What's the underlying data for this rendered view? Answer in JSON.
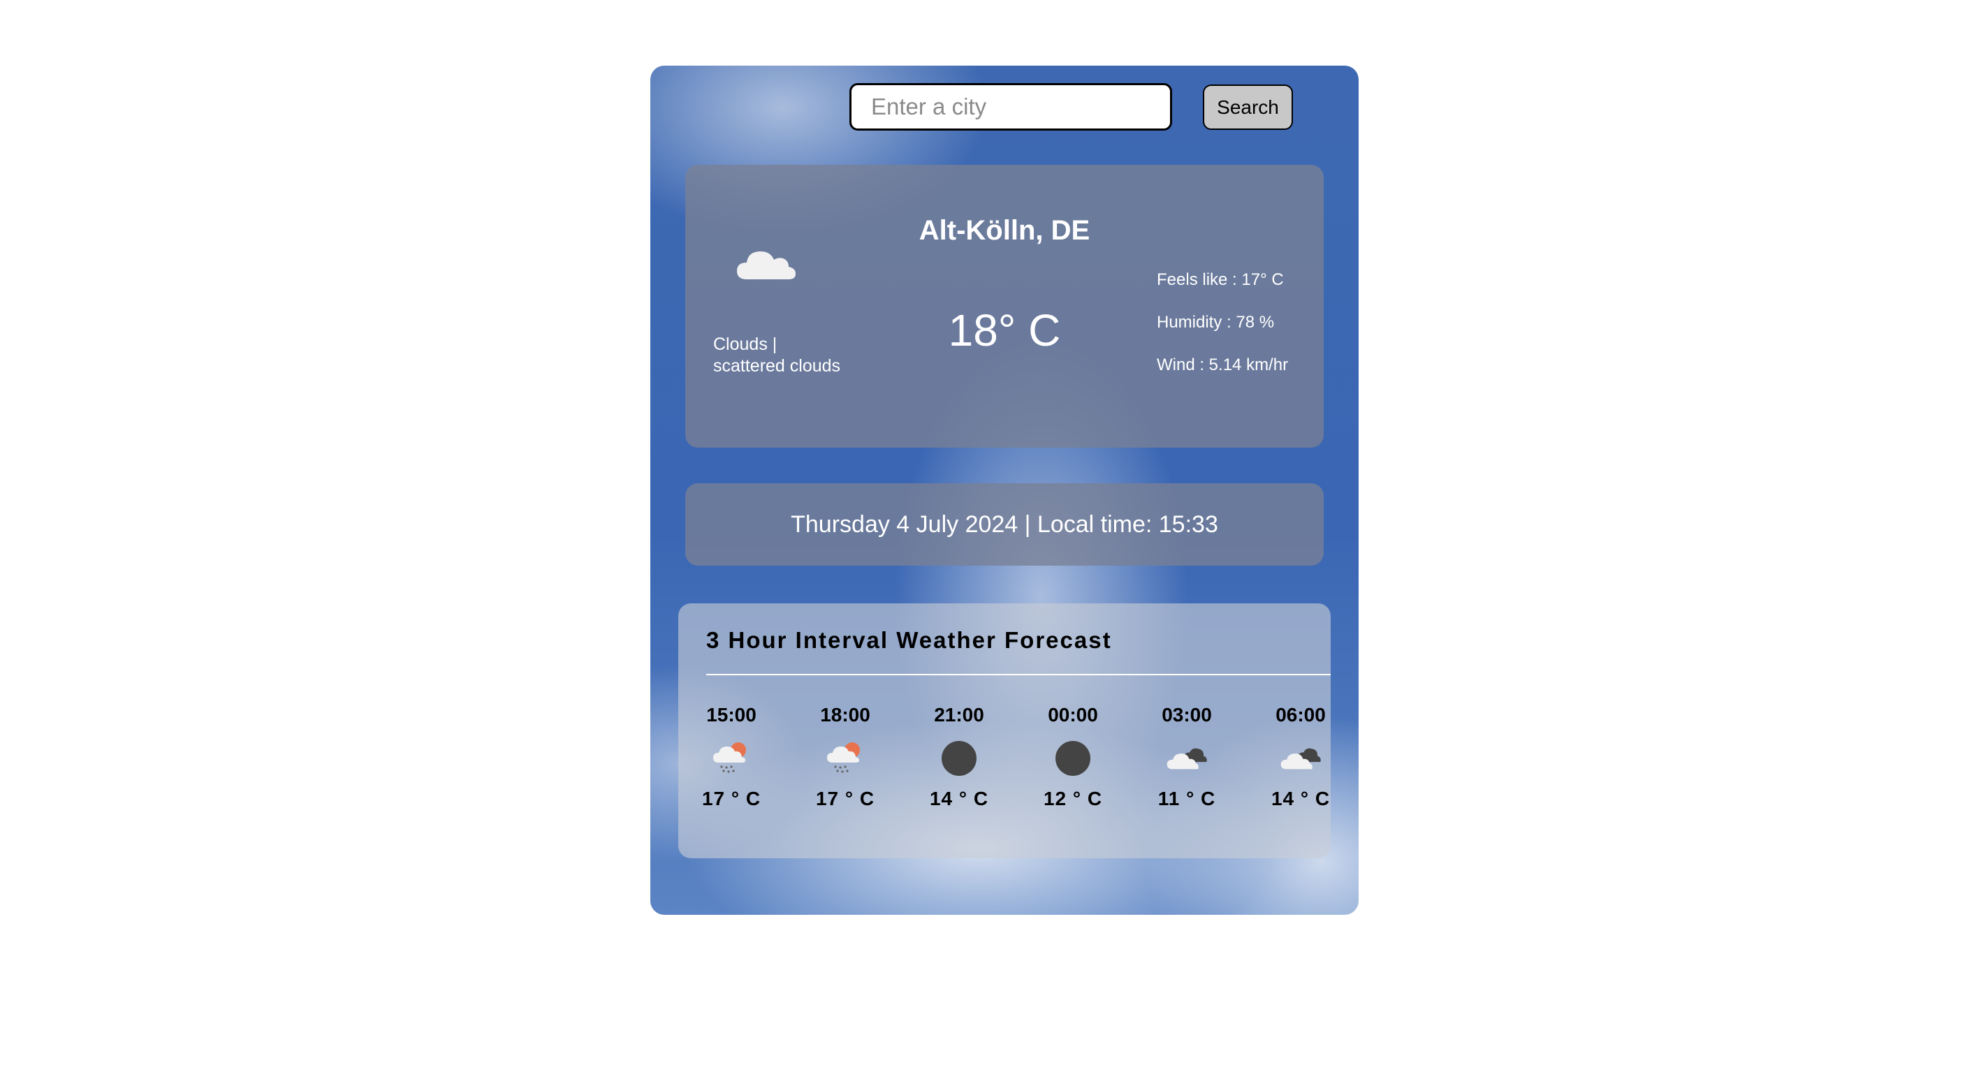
{
  "search": {
    "placeholder": "Enter a city",
    "value": "",
    "button_label": "Search"
  },
  "current": {
    "city": "Alt-Kölln, DE",
    "temperature": "18° C",
    "description_main": "Clouds |",
    "description_detail": "scattered clouds",
    "icon": "cloud-icon",
    "feels_like": "Feels like : 17° C",
    "humidity": "Humidity : 78 %",
    "wind": "Wind : 5.14 km/hr"
  },
  "datetime": {
    "text": "Thursday 4 July 2024 | Local time: 15:33"
  },
  "forecast": {
    "title": "3 Hour Interval Weather Forecast",
    "items": [
      {
        "time": "15:00",
        "temp": "17 ° C",
        "icon": "rain-sun-icon"
      },
      {
        "time": "18:00",
        "temp": "17 ° C",
        "icon": "rain-sun-icon"
      },
      {
        "time": "21:00",
        "temp": "14 ° C",
        "icon": "moon-icon"
      },
      {
        "time": "00:00",
        "temp": "12 ° C",
        "icon": "moon-icon"
      },
      {
        "time": "03:00",
        "temp": "11 ° C",
        "icon": "clouds-icon"
      },
      {
        "time": "06:00",
        "temp": "14 ° C",
        "icon": "clouds-icon"
      }
    ]
  },
  "colors": {
    "card_overlay": "#78809a",
    "accent_sun": "#e8734e",
    "moon": "#444444"
  }
}
